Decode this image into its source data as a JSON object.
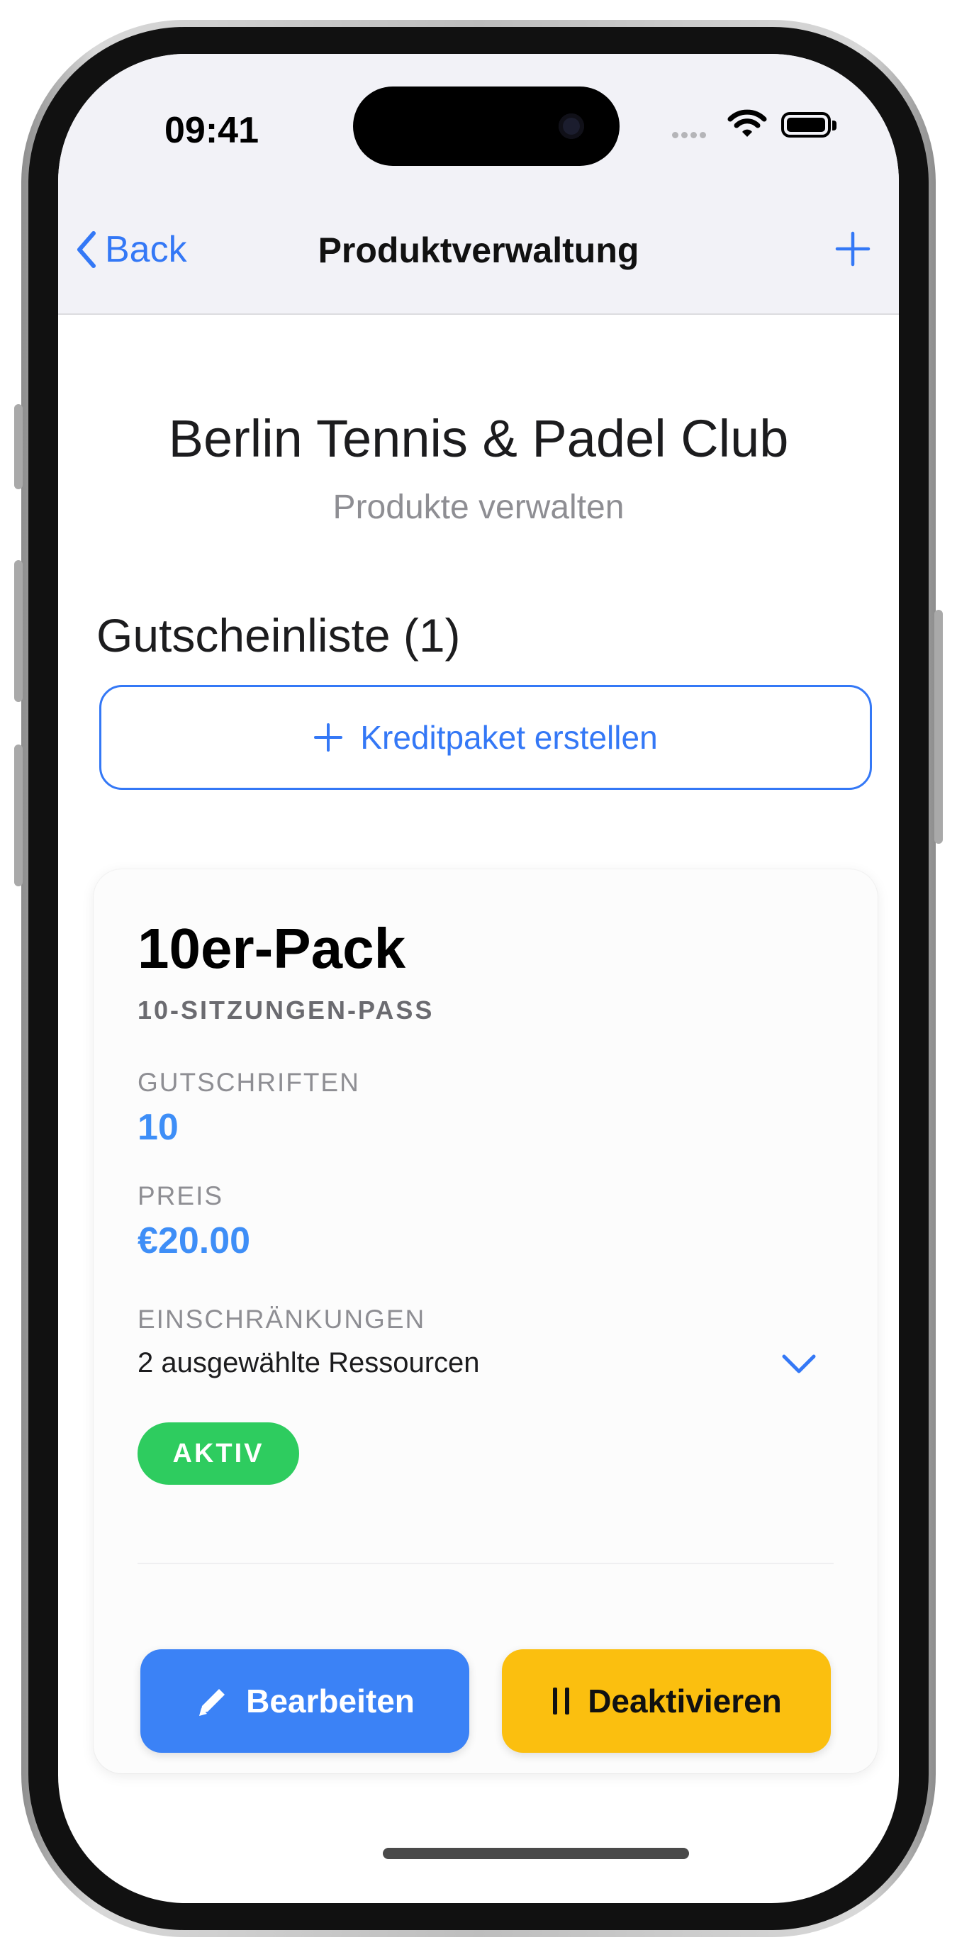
{
  "status_bar": {
    "time": "09:41"
  },
  "nav": {
    "back_label": "Back",
    "title": "Produktverwaltung"
  },
  "header": {
    "club_name": "Berlin Tennis & Padel Club",
    "subtitle": "Produkte verwalten"
  },
  "section": {
    "title": "Gutscheinliste (1)"
  },
  "create_button": {
    "label": "Kreditpaket erstellen"
  },
  "card": {
    "name": "10er-Pack",
    "type": "10-SITZUNGEN-PASS",
    "credits_label": "GUTSCHRIFTEN",
    "credits_value": "10",
    "price_label": "PREIS",
    "price_value": "€20.00",
    "restrictions_label": "EINSCHRÄNKUNGEN",
    "restrictions_value": "2 ausgewählte Ressourcen",
    "status": "AKTIV",
    "edit_label": "Bearbeiten",
    "deactivate_label": "Deaktivieren"
  },
  "colors": {
    "accent": "#3478f6",
    "active_badge": "#2ecc5f",
    "edit_button": "#3b82f6",
    "deactivate_button": "#fbbf0f"
  }
}
